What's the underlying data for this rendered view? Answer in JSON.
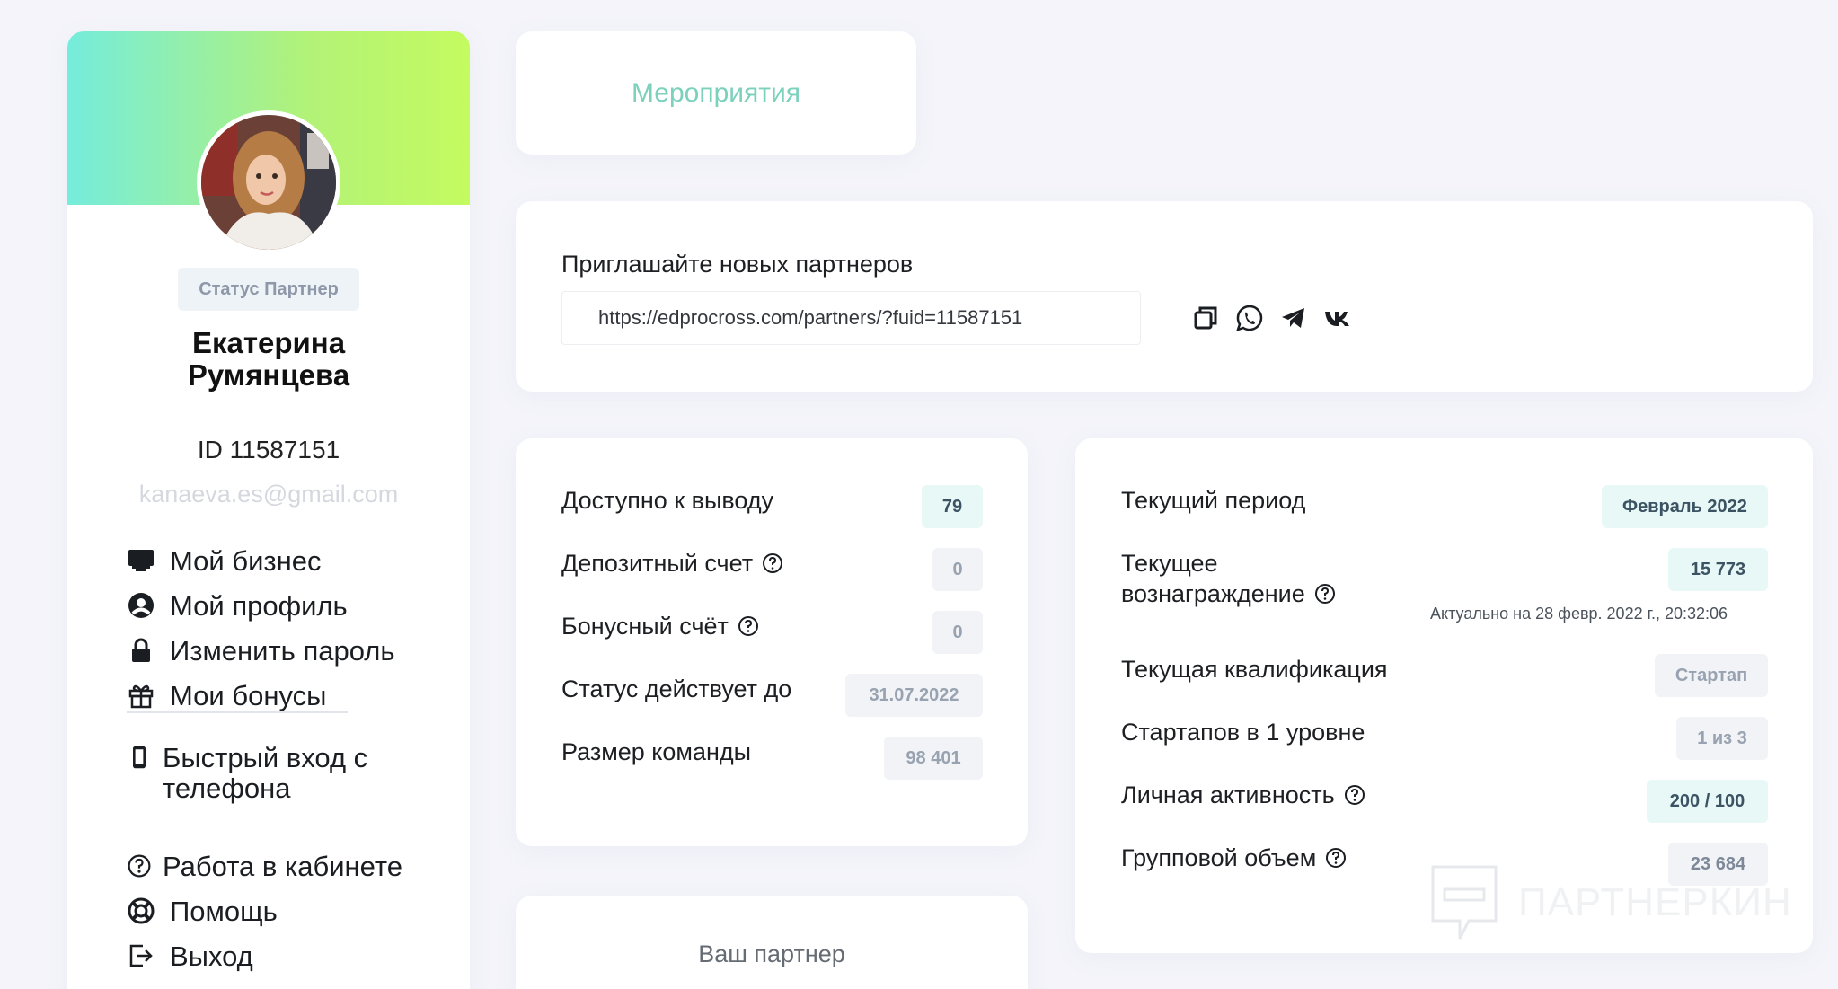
{
  "sidebar": {
    "status_badge": "Статус Партнер",
    "user_name": "Екатерина Румянцева",
    "user_id": "ID 11587151",
    "email": "kanaeva.es@gmail.com",
    "menu_items": [
      {
        "label": "Мой бизнес",
        "icon": "monitor-icon"
      },
      {
        "label": "Мой профиль",
        "icon": "user-circle-icon"
      },
      {
        "label": "Изменить пароль",
        "icon": "lock-icon"
      },
      {
        "label": "Мои бонусы",
        "icon": "gift-icon"
      }
    ],
    "secondary_items": [
      {
        "label": "Быстрый вход с телефона",
        "icon": "phone-icon"
      },
      {
        "label": "Работа в кабинете",
        "icon": "question-circle-icon"
      },
      {
        "label": "Помощь",
        "icon": "lifebuoy-icon"
      },
      {
        "label": "Выход",
        "icon": "logout-icon"
      }
    ],
    "banner_colors": [
      "#75ecdc",
      "#c4fb60"
    ]
  },
  "events": {
    "label": "Мероприятия",
    "color": "#7bd1bc"
  },
  "invite": {
    "title": "Приглашайте новых партнеров",
    "link": "https://edprocross.com/partners/?fuid=11587151",
    "share_icons": [
      "copy-icon",
      "whatsapp-icon",
      "telegram-icon",
      "vk-icon"
    ]
  },
  "balance": {
    "rows": [
      {
        "label": "Доступно к выводу",
        "value": "79",
        "help": false
      },
      {
        "label": "Депозитный счет",
        "value": "0",
        "help": true
      },
      {
        "label": "Бонусный счёт",
        "value": "0",
        "help": true
      },
      {
        "label": "Статус действует до",
        "value": "31.07.2022",
        "help": false
      },
      {
        "label": "Размер команды",
        "value": "98 401",
        "help": false
      }
    ]
  },
  "period": {
    "current_period_label": "Текущий период",
    "current_period_value": "Февраль 2022",
    "reward_label_line1": "Текущее",
    "reward_label_line2": "вознаграждение",
    "reward_value": "15 773",
    "updated_note": "Актуально на 28 февр. 2022 г., 20:32:06",
    "qualification_label": "Текущая квалификация",
    "qualification_value": "Стартап",
    "startups_label": "Стартапов в 1 уровне",
    "startups_value": "1 из 3",
    "activity_label": "Личная активность",
    "activity_value": "200 / 100",
    "group_volume_label": "Групповой объем",
    "group_volume_value": "23 684"
  },
  "partner": {
    "label": "Ваш партнер"
  },
  "watermark": {
    "text": "ПАРТНЕРКИН"
  }
}
